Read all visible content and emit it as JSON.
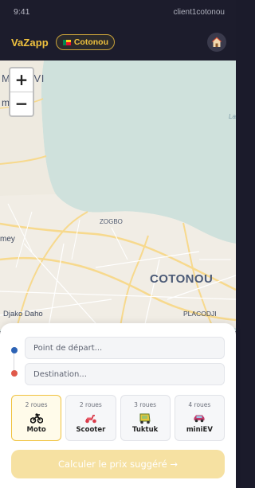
{
  "status_bar": {
    "time": "9:41",
    "user": "client1cotonou"
  },
  "app_bar": {
    "brand": "VaZapp",
    "city": "Cotonou"
  },
  "map": {
    "zoom_in": "+",
    "zoom_out": "−",
    "labels": {
      "malavi_upper": "M ALAVI",
      "malavi_lower": "m lalavi",
      "lake": "Lac",
      "zogbo": "ZOGBO",
      "mey": "mey",
      "cotonou": "COTONOU",
      "djako_daho": "Djako Daho",
      "placodji": "PLACODJI"
    }
  },
  "booking": {
    "departure_placeholder": "Point de départ...",
    "destination_placeholder": "Destination...",
    "vehicles": [
      {
        "wheels": "2 roues",
        "name": "Moto",
        "icon": "motorbike-icon",
        "selected": true
      },
      {
        "wheels": "2 roues",
        "name": "Scooter",
        "icon": "scooter-icon",
        "selected": false
      },
      {
        "wheels": "3 roues",
        "name": "Tuktuk",
        "icon": "tuktuk-icon",
        "selected": false
      },
      {
        "wheels": "4 roues",
        "name": "miniEV",
        "icon": "car-icon",
        "selected": false
      }
    ],
    "cta": "Calculer le prix suggéré →"
  },
  "colors": {
    "accent": "#f0c23e",
    "header_bg": "#1c1c2c",
    "start_dot": "#2d63b5",
    "end_dot": "#e0594a"
  }
}
